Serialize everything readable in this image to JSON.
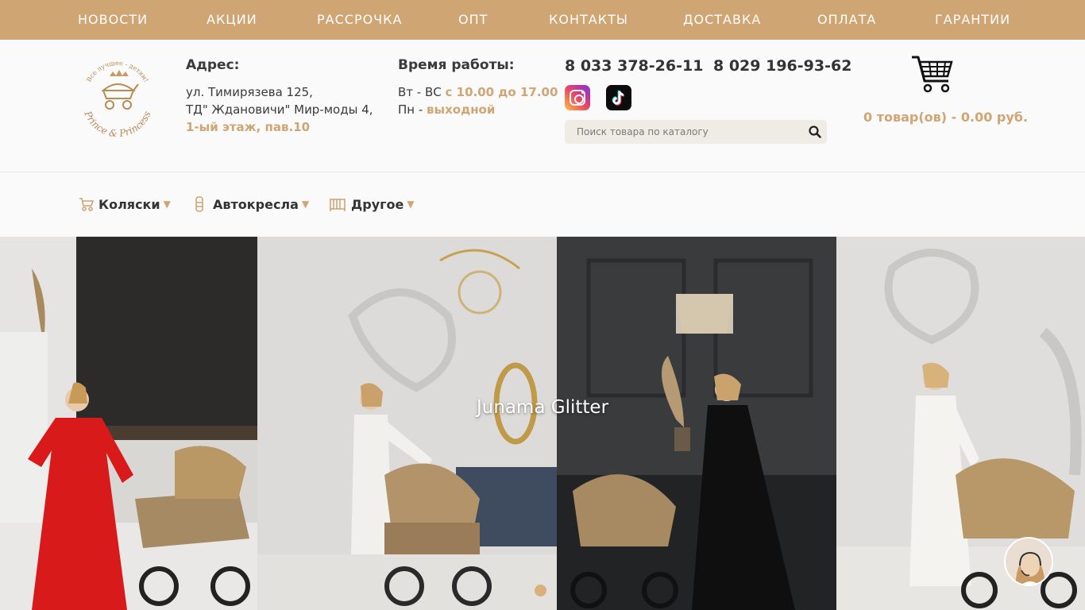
{
  "topnav": [
    "НОВОСТИ",
    "АКЦИИ",
    "РАССРОЧКА",
    "ОПТ",
    "КОНТАКТЫ",
    "ДОСТАВКА",
    "ОПЛАТА",
    "ГАРАНТИИ"
  ],
  "logo": {
    "brand": "Prince & Princess",
    "slogan": "Все лучшее - детям!"
  },
  "address": {
    "title": "Адрес:",
    "line1": "ул. Тимирязева 125,",
    "line2": "ТД\" Ждановичи\" Мир-моды 4,",
    "line3": "1-ый этаж, пав.10"
  },
  "hours": {
    "title": "Время работы:",
    "row1_label": "Вт - ВС ",
    "row1_value": "с 10.00 до 17.00",
    "row2_label": "Пн - ",
    "row2_value": "выходной"
  },
  "phones": [
    "8 033 378-26-11",
    "8 029 196-93-62"
  ],
  "social": {
    "instagram_icon": "instagram-icon",
    "tiktok_icon": "tiktok-icon"
  },
  "search": {
    "placeholder": "Поиск товара по каталогу"
  },
  "cart": {
    "summary": "0 товар(ов) - 0.00 руб."
  },
  "categories": [
    {
      "label": "Коляски",
      "icon": "stroller-icon"
    },
    {
      "label": "Автокресла",
      "icon": "car-seat-icon"
    },
    {
      "label": "Другое",
      "icon": "crib-icon"
    }
  ],
  "hero": {
    "caption": "Junama Glitter",
    "slides": 1,
    "active_slide": 1
  },
  "colors": {
    "accent": "#cfa574",
    "topnav_bg": "#cfa574",
    "text": "#3a3a3a"
  }
}
